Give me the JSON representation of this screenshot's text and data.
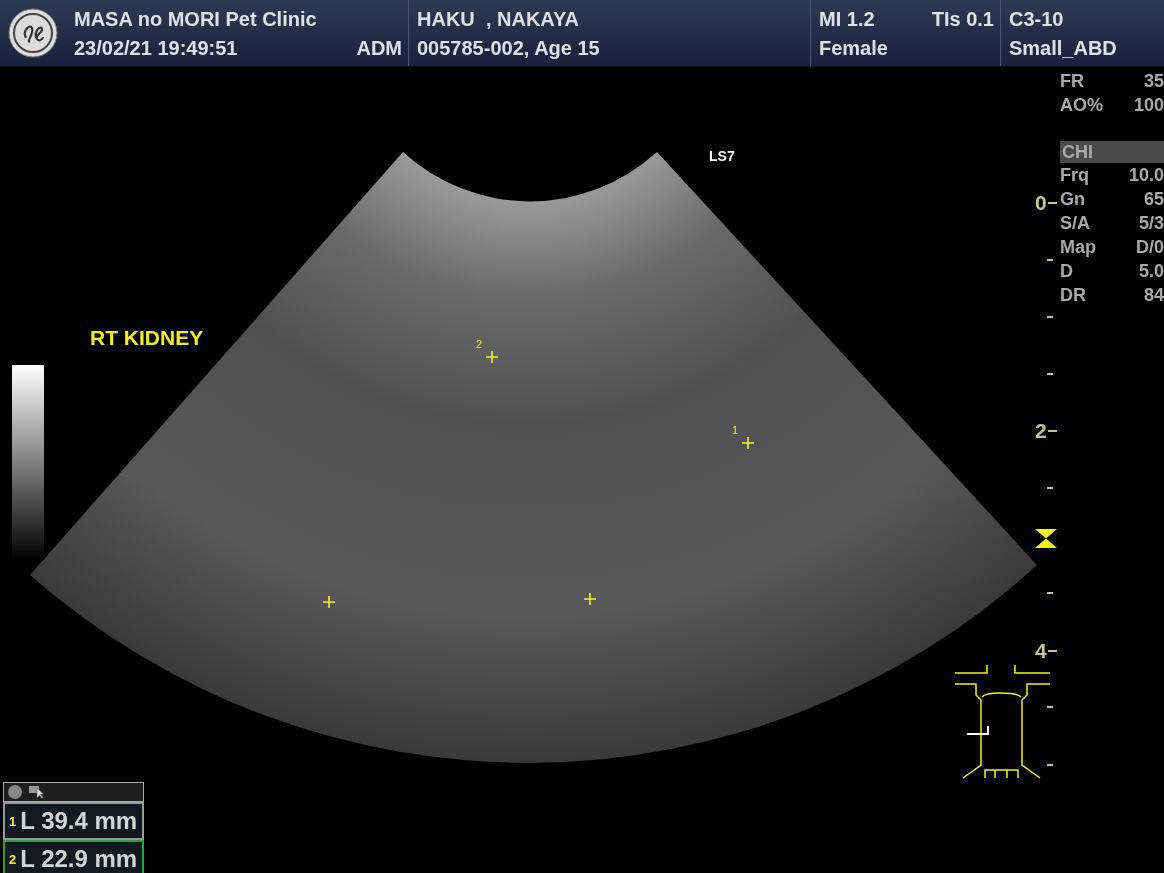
{
  "header": {
    "clinic": "MASA no MORI Pet Clinic",
    "datetime": "23/02/21 19:49:51",
    "operator": "ADM",
    "patient_name": "HAKU  , NAKAYA",
    "patient_id_age": "005785-002, Age 15",
    "mi": "MI 1.2",
    "tis": "TIs 0.1",
    "sex": "Female",
    "probe": "C3-10",
    "preset": "Small_ABD"
  },
  "image": {
    "annotation": "RT KIDNEY",
    "orientation_mark": "LS7",
    "calipers": [
      {
        "label": "2"
      },
      {
        "label": "1"
      }
    ]
  },
  "params": [
    {
      "kind": "value",
      "name": "FR",
      "value": "35"
    },
    {
      "kind": "value",
      "name": "AO%",
      "value": "100"
    },
    {
      "kind": "header",
      "name": "CHI"
    },
    {
      "kind": "value",
      "name": "Frq",
      "value": "10.0"
    },
    {
      "kind": "value",
      "name": "Gn",
      "value": "65"
    },
    {
      "kind": "value",
      "name": "S/A",
      "value": "5/3"
    },
    {
      "kind": "value",
      "name": "Map",
      "value": "D/0"
    },
    {
      "kind": "value",
      "name": "D",
      "value": "5.0"
    },
    {
      "kind": "value",
      "name": "DR",
      "value": "84"
    }
  ],
  "depth_scale": {
    "labels": [
      "0",
      "2",
      "4"
    ]
  },
  "measurements": [
    {
      "index": "1",
      "text": "L 39.4 mm",
      "selected": false
    },
    {
      "index": "2",
      "text": "L 22.9 mm",
      "selected": true
    }
  ]
}
